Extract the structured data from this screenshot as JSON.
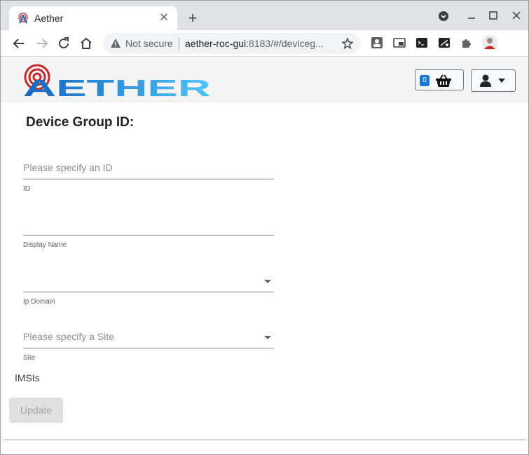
{
  "browser": {
    "tab_title": "Aether",
    "security_status": "Not secure",
    "url_host": "aether-roc-gui",
    "url_rest": ":8183/#/deviceg..."
  },
  "header": {
    "logo_text": "AETHER",
    "basket_count": "0"
  },
  "form": {
    "title": "Device Group ID:",
    "id_field": {
      "placeholder": "Please specify an ID",
      "value": "",
      "label": "ID"
    },
    "display_name_field": {
      "value": "",
      "label": "Display Name"
    },
    "ip_domain_field": {
      "value": "",
      "label": "Ip Domain"
    },
    "site_field": {
      "placeholder": "Please specify a Site",
      "label": "Site"
    },
    "imsis_label": "IMSIs",
    "update_label": "Update"
  },
  "colors": {
    "accent": "#1976d2",
    "logo_red": "#c62828",
    "logo_blue": "#1565c0",
    "logo_cyan": "#29b6f6"
  },
  "icons": [
    "aether-favicon",
    "close-icon",
    "plus-icon",
    "back-icon",
    "forward-icon",
    "reload-icon",
    "home-icon",
    "warning-icon",
    "star-icon",
    "extension-icon",
    "basket-icon",
    "user-icon",
    "chevron-down-icon"
  ]
}
